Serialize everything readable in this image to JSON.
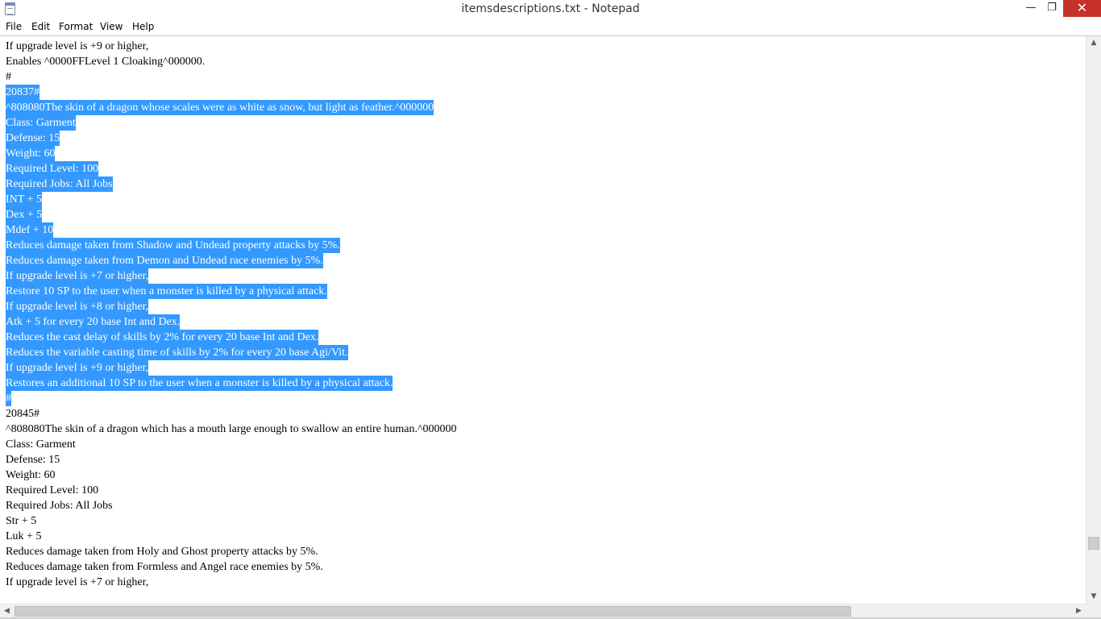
{
  "window": {
    "title": "itemsdescriptions.txt - Notepad",
    "minimize_glyph": "—",
    "restore_glyph": "❐",
    "close_glyph": "✕"
  },
  "menu": {
    "items": [
      "File",
      "Edit",
      "Format",
      "View",
      "Help"
    ]
  },
  "editor": {
    "selection_color": "#3399ff",
    "lines": [
      {
        "text": "If upgrade level is +9 or higher,",
        "selected": false
      },
      {
        "text": "Enables ^0000FFLevel 1 Cloaking^000000.",
        "selected": false
      },
      {
        "text": "#",
        "selected": false
      },
      {
        "text": "20837#",
        "selected": true
      },
      {
        "text": "^808080The skin of a dragon whose scales were as white as snow, but light as feather.^000000",
        "selected": true
      },
      {
        "text": "Class: Garment",
        "selected": true
      },
      {
        "text": "Defense: 15",
        "selected": true
      },
      {
        "text": "Weight: 60",
        "selected": true
      },
      {
        "text": "Required Level: 100",
        "selected": true
      },
      {
        "text": "Required Jobs: All Jobs",
        "selected": true
      },
      {
        "text": "INT + 5",
        "selected": true
      },
      {
        "text": "Dex + 5",
        "selected": true
      },
      {
        "text": "Mdef + 10",
        "selected": true
      },
      {
        "text": "Reduces damage taken from Shadow and Undead property attacks by 5%.",
        "selected": true
      },
      {
        "text": "Reduces damage taken from Demon and Undead race enemies by 5%.",
        "selected": true
      },
      {
        "text": "If upgrade level is +7 or higher,",
        "selected": true
      },
      {
        "text": "Restore 10 SP to the user when a monster is killed by a physical attack.",
        "selected": true
      },
      {
        "text": "If upgrade level is +8 or higher,",
        "selected": true
      },
      {
        "text": "Atk + 5 for every 20 base Int and Dex.",
        "selected": true
      },
      {
        "text": "Reduces the cast delay of skills by 2% for every 20 base Int and Dex.",
        "selected": true
      },
      {
        "text": "Reduces the variable casting time of skills by 2% for every 20 base Agi/Vit.",
        "selected": true
      },
      {
        "text": "If upgrade level is +9 or higher,",
        "selected": true
      },
      {
        "text": "Restores an additional 10 SP to the user when a monster is killed by a physical attack.",
        "selected": true
      },
      {
        "text": "#",
        "selected": true
      },
      {
        "text": "20845#",
        "selected": false
      },
      {
        "text": "^808080The skin of a dragon which has a mouth large enough to swallow an entire human.^000000",
        "selected": false
      },
      {
        "text": "Class: Garment",
        "selected": false
      },
      {
        "text": "Defense: 15",
        "selected": false
      },
      {
        "text": "Weight: 60",
        "selected": false
      },
      {
        "text": "Required Level: 100",
        "selected": false
      },
      {
        "text": "Required Jobs: All Jobs",
        "selected": false
      },
      {
        "text": "Str + 5",
        "selected": false
      },
      {
        "text": "Luk + 5",
        "selected": false
      },
      {
        "text": "Reduces damage taken from Holy and Ghost property attacks by 5%.",
        "selected": false
      },
      {
        "text": "Reduces damage taken from Formless and Angel race enemies by 5%.",
        "selected": false
      },
      {
        "text": "If upgrade level is +7 or higher,",
        "selected": false
      }
    ]
  },
  "scrollbars": {
    "up_glyph": "▲",
    "down_glyph": "▼",
    "left_glyph": "◀",
    "right_glyph": "▶"
  }
}
